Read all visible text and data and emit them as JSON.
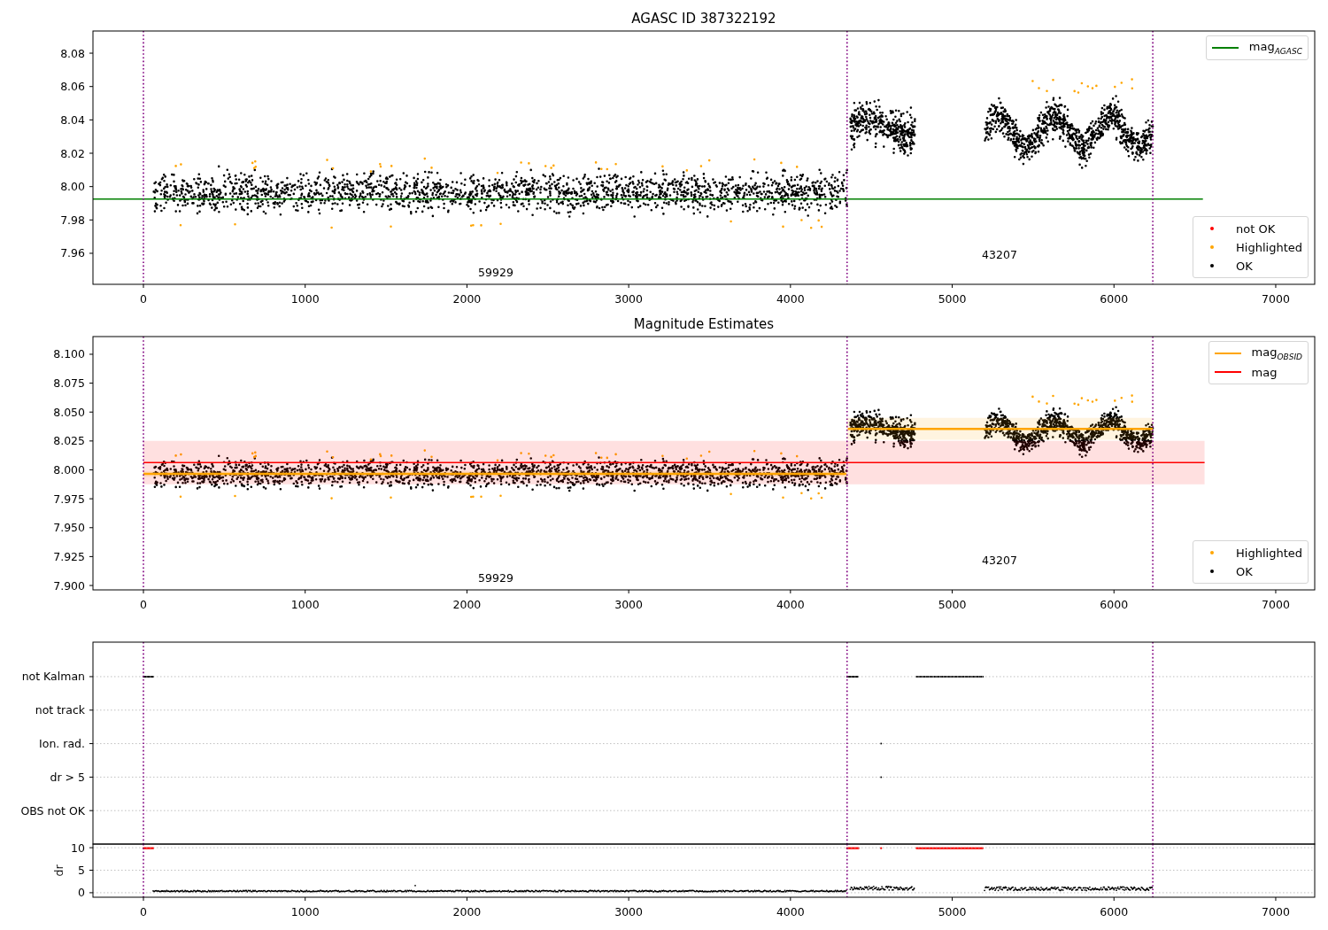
{
  "figure": {
    "panels": [
      {
        "kind": "magnitude",
        "title": "AGASC ID 387322192",
        "chart_data": {
          "type": "line",
          "xlim": [
            -312,
            7241
          ],
          "ylim": [
            7.9414,
            8.0933
          ],
          "xticks": [
            0,
            1000,
            2000,
            3000,
            4000,
            5000,
            6000,
            7000
          ],
          "yticks": [
            {
              "value": 7.96,
              "label": "7.96"
            },
            {
              "value": 7.98,
              "label": "7.98"
            },
            {
              "value": 8.0,
              "label": "8.00"
            },
            {
              "value": 8.02,
              "label": "8.02"
            },
            {
              "value": 8.04,
              "label": "8.04"
            },
            {
              "value": 8.06,
              "label": "8.06"
            },
            {
              "value": 8.08,
              "label": "8.08"
            }
          ],
          "ref_lines": [
            {
              "axis": "x",
              "value": 0,
              "color": "#800080"
            },
            {
              "axis": "x",
              "value": 4350,
              "color": "#800080"
            },
            {
              "axis": "x",
              "value": 6240,
              "color": "#800080"
            }
          ],
          "series": [
            {
              "name": "mag$_{AGASC}$",
              "color": "#008000",
              "x": [
                -312,
                6550
              ],
              "values": [
                7.9925,
                7.9925
              ]
            }
          ],
          "annotations": [
            "59929",
            "43207"
          ]
        },
        "markers": [
          {
            "label": "not OK",
            "color": "#ff0000"
          },
          {
            "label": "Highlighted",
            "color": "#ffa500"
          },
          {
            "label": "OK",
            "color": "#000000"
          }
        ]
      },
      {
        "kind": "magnitude",
        "title": "Magnitude Estimates",
        "chart_data": {
          "type": "line",
          "xlim": [
            -312,
            7241
          ],
          "ylim": [
            7.8962,
            8.1153
          ],
          "xticks": [
            0,
            1000,
            2000,
            3000,
            4000,
            5000,
            6000,
            7000
          ],
          "yticks": [
            {
              "value": 7.9,
              "label": "7.900"
            },
            {
              "value": 7.925,
              "label": "7.925"
            },
            {
              "value": 7.95,
              "label": "7.950"
            },
            {
              "value": 7.975,
              "label": "7.975"
            },
            {
              "value": 8.0,
              "label": "8.000"
            },
            {
              "value": 8.025,
              "label": "8.025"
            },
            {
              "value": 8.05,
              "label": "8.050"
            },
            {
              "value": 8.075,
              "label": "8.075"
            },
            {
              "value": 8.1,
              "label": "8.100"
            }
          ],
          "ref_lines": [
            {
              "axis": "x",
              "value": 0,
              "color": "#800080"
            },
            {
              "axis": "x",
              "value": 4350,
              "color": "#800080"
            },
            {
              "axis": "x",
              "value": 6240,
              "color": "#800080"
            }
          ],
          "bands": [
            {
              "axis": "y",
              "from": 7.9875,
              "to": 8.0251,
              "color": "#ff0000"
            },
            {
              "axis": "y",
              "from": 7.994,
              "to": 7.999,
              "color": "#ffa500"
            },
            {
              "axis": "y",
              "from": 8.026,
              "to": 8.045,
              "color": "#ffa500"
            }
          ],
          "series": [
            {
              "name": "mag$_{OBSID}$",
              "color": "#ffa500",
              "x": [
                0,
                4345,
                4350,
                4355,
                6240
              ],
              "values": [
                7.9965,
                7.9965,
                null,
                8.0355,
                8.0355
              ]
            },
            {
              "name": "mag",
              "color": "#ff0000",
              "x": [
                0,
                6560
              ],
              "values": [
                8.0063,
                8.0063
              ]
            }
          ],
          "annotations": [
            "59929",
            "43207"
          ]
        },
        "markers": [
          {
            "label": "Highlighted",
            "color": "#ffa500"
          },
          {
            "label": "OK",
            "color": "#000000"
          }
        ]
      },
      {
        "kind": "flags",
        "chart_data": {
          "type": "scatter",
          "grid": true,
          "xlim": [
            -312,
            7241
          ],
          "orientation": "horizontal",
          "categories": [
            "not Kalman",
            "not track",
            "Ion. rad.",
            "dr > 5",
            "OBS not OK"
          ],
          "ref_lines": [
            {
              "axis": "x",
              "value": 0,
              "color": "#800080"
            },
            {
              "axis": "x",
              "value": 4350,
              "color": "#800080"
            },
            {
              "axis": "x",
              "value": 6240,
              "color": "#800080"
            }
          ]
        },
        "sub_chart": {
          "chart_data": {
            "type": "scatter",
            "grid": true,
            "ylabel": "dr",
            "xlim": [
              -312,
              7241
            ],
            "ylim": [
              -1,
              10.8
            ],
            "xticks": [
              0,
              1000,
              2000,
              3000,
              4000,
              5000,
              6000,
              7000
            ],
            "yticks": [
              0,
              5,
              10
            ],
            "ref_lines": [
              {
                "axis": "x",
                "value": 0,
                "color": "#800080"
              },
              {
                "axis": "x",
                "value": 4350,
                "color": "#800080"
              },
              {
                "axis": "x",
                "value": 6240,
                "color": "#800080"
              }
            ]
          }
        }
      }
    ]
  }
}
